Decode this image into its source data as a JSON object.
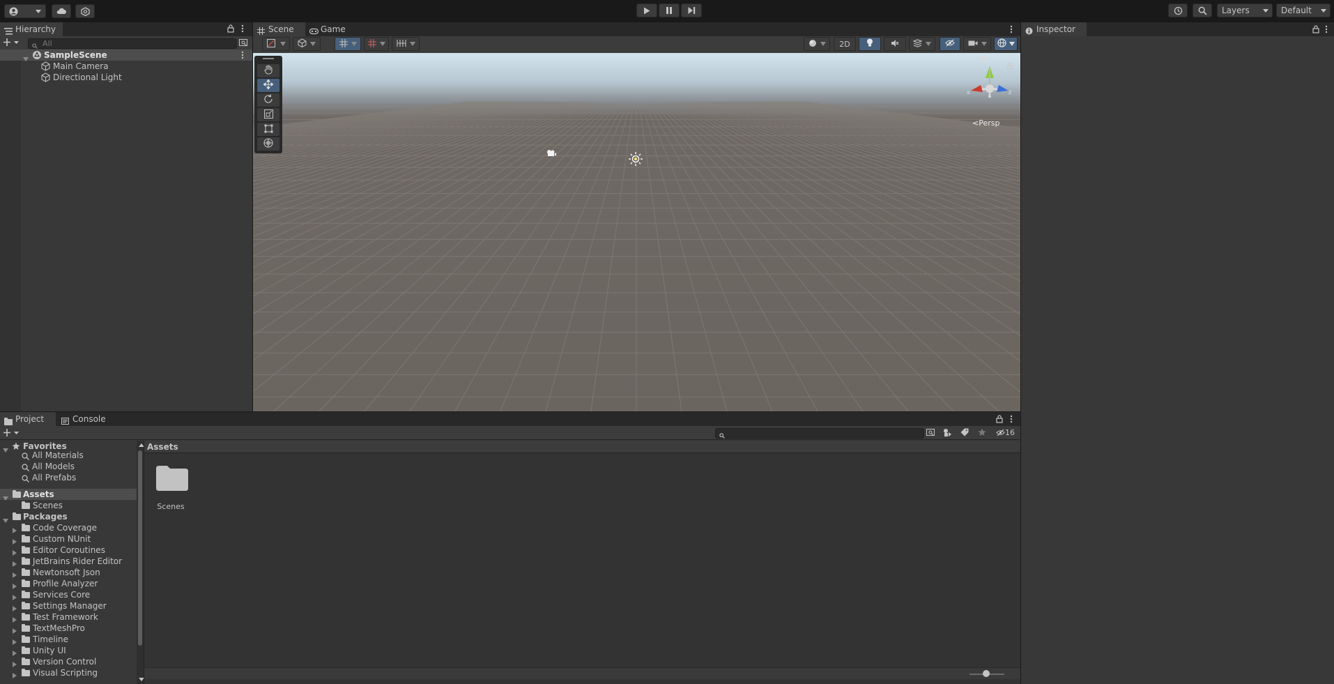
{
  "toolbar": {
    "account_icon": "account-icon",
    "cloud_icon": "cloud-icon",
    "collab_icon": "collab-icon",
    "play_icon": "play-icon",
    "pause_icon": "pause-icon",
    "step_icon": "step-icon",
    "history_icon": "history-icon",
    "search_icon": "search-icon",
    "layers_label": "Layers",
    "layout_label": "Default"
  },
  "hierarchy": {
    "tab_label": "Hierarchy",
    "search_placeholder": "All",
    "scene_name": "SampleScene",
    "items": [
      {
        "label": "Main Camera"
      },
      {
        "label": "Directional Light"
      }
    ]
  },
  "scene_view": {
    "tabs": [
      {
        "label": "Scene"
      },
      {
        "label": "Game"
      }
    ],
    "toggle_2d": "2D",
    "persp_label": "Persp",
    "gizmo_axes": {
      "x": "x",
      "z": "z"
    },
    "colors": {
      "sky_top": "#c7dbe6",
      "horizon": "#8d949a",
      "ground": "#6e6762",
      "grid": "#8a837e",
      "accent": "#46607c"
    }
  },
  "inspector": {
    "tab_label": "Inspector"
  },
  "project": {
    "tabs": [
      {
        "label": "Project"
      },
      {
        "label": "Console"
      }
    ],
    "hidden_count": "16",
    "breadcrumb": "Assets",
    "favorites_label": "Favorites",
    "favorites": [
      {
        "label": "All Materials"
      },
      {
        "label": "All Models"
      },
      {
        "label": "All Prefabs"
      }
    ],
    "assets_label": "Assets",
    "assets_children": [
      {
        "label": "Scenes"
      }
    ],
    "packages_label": "Packages",
    "packages": [
      {
        "label": "Code Coverage"
      },
      {
        "label": "Custom NUnit"
      },
      {
        "label": "Editor Coroutines"
      },
      {
        "label": "JetBrains Rider Editor"
      },
      {
        "label": "Newtonsoft Json"
      },
      {
        "label": "Profile Analyzer"
      },
      {
        "label": "Services Core"
      },
      {
        "label": "Settings Manager"
      },
      {
        "label": "Test Framework"
      },
      {
        "label": "TextMeshPro"
      },
      {
        "label": "Timeline"
      },
      {
        "label": "Unity UI"
      },
      {
        "label": "Version Control"
      },
      {
        "label": "Visual Scripting"
      }
    ],
    "grid_items": [
      {
        "label": "Scenes"
      }
    ]
  }
}
